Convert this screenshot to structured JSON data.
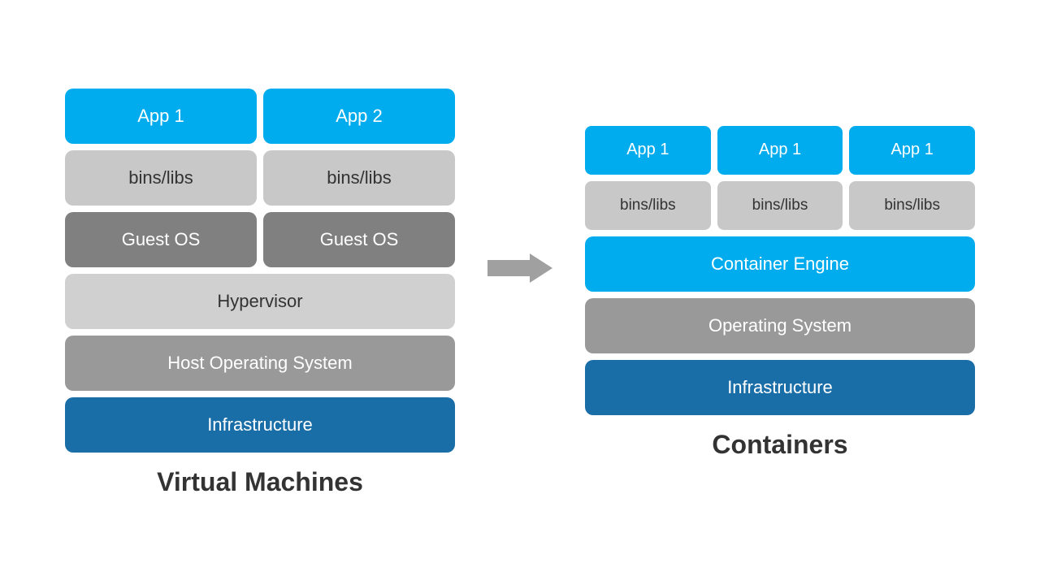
{
  "left": {
    "title": "Virtual Machines",
    "rows": {
      "apps": [
        "App 1",
        "App 2"
      ],
      "bins": [
        "bins/libs",
        "bins/libs"
      ],
      "guestos": [
        "Guest OS",
        "Guest OS"
      ],
      "hypervisor": "Hypervisor",
      "hostos": "Host Operating System",
      "infra": "Infrastructure"
    }
  },
  "right": {
    "title": "Containers",
    "rows": {
      "apps": [
        "App 1",
        "App 1",
        "App 1"
      ],
      "bins": [
        "bins/libs",
        "bins/libs",
        "bins/libs"
      ],
      "engine": "Container Engine",
      "os": "Operating System",
      "infra": "Infrastructure"
    }
  },
  "arrow": "→"
}
